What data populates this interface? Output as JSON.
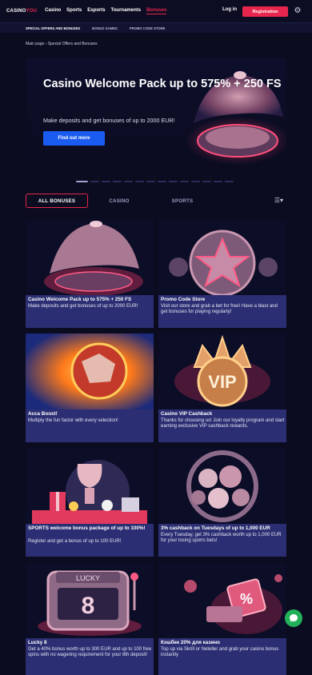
{
  "header": {
    "logo_main": "CASINO",
    "logo_accent": "YOU",
    "nav": [
      "Casino",
      "Sports",
      "Esports",
      "Tournaments",
      "Bonuses"
    ],
    "login": "Log in",
    "register": "Registration"
  },
  "subnav": [
    "SPECIAL OFFERS AND BONUSES",
    "BONUS GAMES",
    "PROMO CODE STORE"
  ],
  "breadcrumb": "Main page › Special Offers and Bonuses",
  "hero": {
    "title": "Casino Welcome Pack up to 575% + 250 FS",
    "subtitle": "Make deposits and get bonuses of up to 2000 EUR!",
    "button": "Find out more"
  },
  "tabs": [
    "ALL BONUSES",
    "CASINO",
    "SPORTS"
  ],
  "cards": [
    {
      "title": "Casino Welcome Pack up to 575% + 250 FS",
      "desc": "Make deposits and get bonuses of up to 2000 EUR!"
    },
    {
      "title": "Promo Code Store",
      "desc": "Visit our store and grab a bet for free! Have a blast and get bonuses for playing regularly!"
    },
    {
      "title": "Acca Boost!",
      "desc": "Multiply the fun factor with every selection!"
    },
    {
      "title": "Casino VIP Cashback",
      "desc": "Thanks for choosing us! Join our loyalty program and start earning exclusive VIP cashback rewards."
    },
    {
      "title": "SPORTS welcome bonus package of up to 100%!",
      "desc": "Register and get a bonus of up to 100 EUR!"
    },
    {
      "title": "3% cashback on Tuesdays of up to 1,000 EUR",
      "desc": "Every Tuesday, get 3% cashback worth up to 1,000 EUR for your losing sports bets!"
    },
    {
      "title": "Lucky 8",
      "desc": "Get a 40% bonus worth up to 300 EUR and up to 100 free spins with no wagering requirement for your 8th deposit!"
    },
    {
      "title": "Кэшбек 20% для казино",
      "desc": "Top up via Skrill or Neteller and grab your casino bonus instantly"
    }
  ],
  "vip_text": "VIP",
  "lucky_text": "LUCKY",
  "colors": {
    "accent": "#e8264d",
    "primary_button": "#1b5cf0",
    "card_bg": "#2b2e72",
    "page_bg": "#0b0c20"
  }
}
